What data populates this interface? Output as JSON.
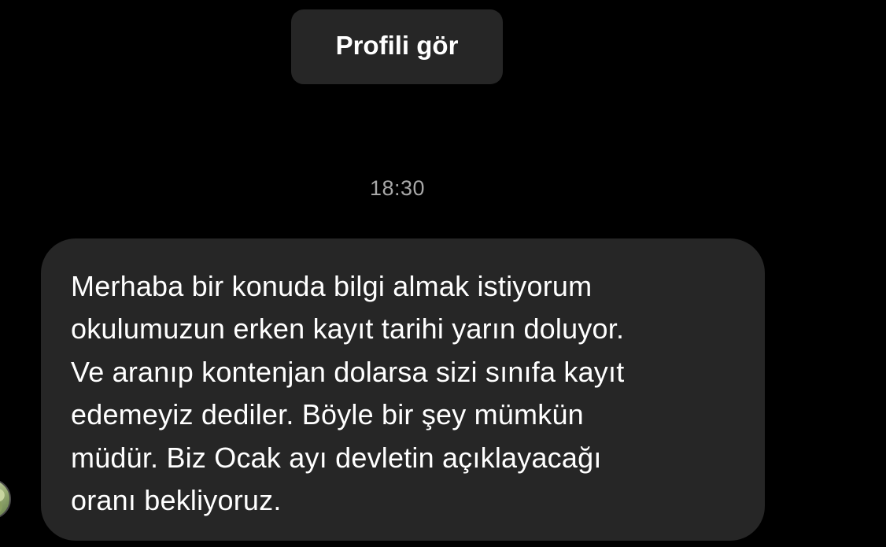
{
  "header": {
    "view_profile_label": "Profili gör"
  },
  "chat": {
    "timestamp": "18:30",
    "message": {
      "lines": [
        "Merhaba bir konuda bilgi almak istiyorum",
        "okulumuzun erken kayıt tarihi yarın doluyor.",
        "Ve aranıp kontenjan dolarsa sizi sınıfa kayıt",
        "edemeyiz dediler. Böyle bir şey mümkün",
        "müdür. Biz Ocak ayı devletin açıklayacağı",
        "oranı bekliyoruz."
      ]
    }
  },
  "colors": {
    "background": "#000000",
    "bubble": "#262626",
    "text": "#ffffff",
    "timestamp": "#a8a8a8"
  }
}
